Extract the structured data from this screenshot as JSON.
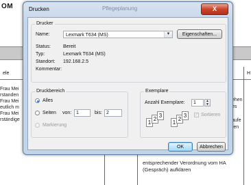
{
  "background": {
    "title": "OM",
    "subtitle": "",
    "header_left": "ele",
    "header_right": "H",
    "left_text": "Frau Mei\nrstanden\nFrau Mei\neutlich m\nFrau Mei\nrständige",
    "right_text": "ehen\nes\n\naufe\nren",
    "bottom_text": "entsprechender Verordnung vom HA\n(Gespräch) aufklären"
  },
  "dialog": {
    "title": "Drucken",
    "faded_title": "Pflegeplanung",
    "close_label": "X",
    "printer": {
      "group_label": "Drucker",
      "name_label": "Name:",
      "name_value": "Lexmark T634 (MS)",
      "properties_button": "Eigenschaften...",
      "status_label": "Status:",
      "status_value": "Bereit",
      "type_label": "Typ:",
      "type_value": "Lexmark T634 (MS)",
      "location_label": "Standort:",
      "location_value": "192.168.2.5",
      "comment_label": "Kommentar:",
      "comment_value": ""
    },
    "print_range": {
      "group_label": "Druckbereich",
      "all_label": "Alles",
      "pages_label": "Seiten",
      "from_label": "von:",
      "from_value": "1",
      "to_label": "bis:",
      "to_value": "2",
      "selection_label": "Markierung",
      "selected": "all"
    },
    "copies": {
      "group_label": "Exemplare",
      "count_label": "Anzahl Exemplare:",
      "count_value": "1",
      "collate_label": "Sortieren",
      "collate_checked": true
    },
    "ok_button": "OK",
    "cancel_button": "Abbrechen"
  }
}
